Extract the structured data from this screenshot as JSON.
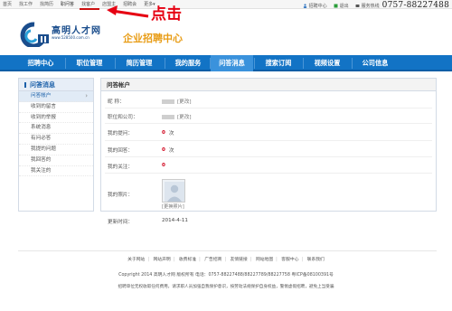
{
  "topnav": [
    "首页",
    "找工作",
    "找简历",
    "职问答",
    "找客户",
    "店盟主",
    "招聘会",
    "更多"
  ],
  "topnav_more_arrow": "▾",
  "top_right": {
    "recruit_center": "招聘中心",
    "logout": "退出",
    "hotline_label": "服务热线",
    "hotline_number": "0757-88227488"
  },
  "annotation": {
    "text": "点击",
    "color": "#e60012"
  },
  "logo": {
    "name": "高明人才网",
    "url": "www.528500.com.cn",
    "subtitle": "企业招聘中心"
  },
  "mainnav": [
    "招聘中心",
    "职位管理",
    "简历管理",
    "我的服务",
    "问答消息",
    "搜索订阅",
    "视频设置",
    "公司信息"
  ],
  "mainnav_active": "问答消息",
  "sidebar": {
    "title": "问答消息",
    "items": [
      "问答帐户",
      "收到的留言",
      "收到的举报",
      "系统消息",
      "有问必答",
      "我提的问题",
      "我回答的",
      "我关注的"
    ]
  },
  "content": {
    "title": "问答帐户",
    "rows": {
      "nickname": {
        "label": "昵  称：",
        "action": "[更改]"
      },
      "position": {
        "label": "职位和公司：",
        "action": "[更改]"
      },
      "questions": {
        "label": "我的提问：",
        "value": "0",
        "unit": "次"
      },
      "answers": {
        "label": "我的回答：",
        "value": "0",
        "unit": "次"
      },
      "follows": {
        "label": "我的关注：",
        "value": "0"
      },
      "photo": {
        "label": "我的照片：",
        "action": "[更换照片]"
      },
      "updated": {
        "label": "更新时间：",
        "value": "2014-4-11"
      }
    }
  },
  "footer": {
    "links": [
      "关于网站",
      "网站声明",
      "收费标准",
      "广告招商",
      "友情链接",
      "网站地图",
      "客服中心",
      "联系我们"
    ],
    "copyright": "Copyright  2014  高明人才网  版权所有  电话：0757-88227488/88227789/88227758  粤ICP备08100391号",
    "disclaimer": "招聘单位无权收取任何费用，请求职人员加强自我保护意识，按劳动法规保护自身权益，警惕虚假招聘，避免上当受骗"
  },
  "colors": {
    "nav_blue": "#1273c5",
    "nav_active": "#3a92dc",
    "accent_red": "#d0021b",
    "logo_blue": "#1a4d8c",
    "logo_orange": "#e89c15"
  }
}
